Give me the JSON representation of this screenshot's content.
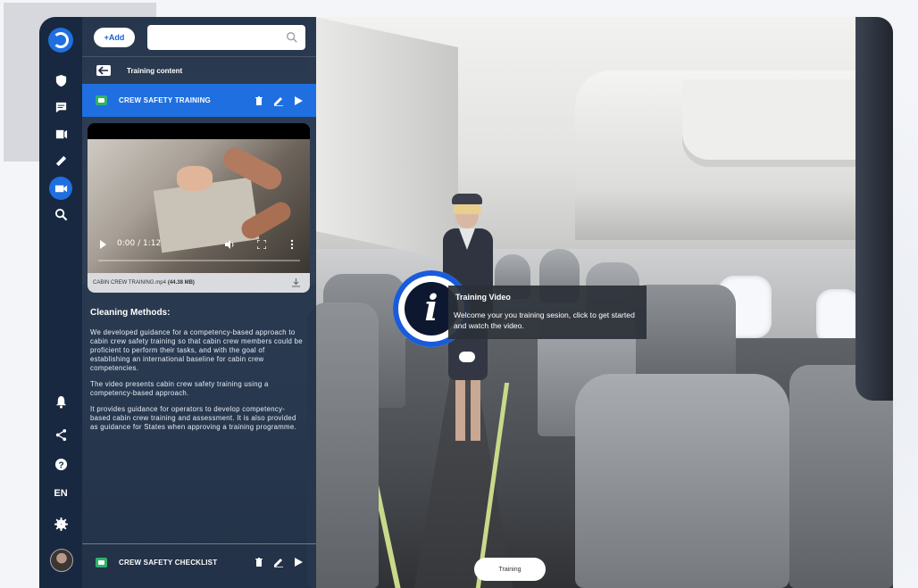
{
  "toolbar": {
    "add_label": "+Add",
    "search_value": ""
  },
  "section": {
    "title": "Training content"
  },
  "items": [
    {
      "label": "CREW SAFETY TRAINING",
      "icon": "video-icon",
      "active": true
    },
    {
      "label": "CREW SAFETY CHECKLIST",
      "icon": "checklist-icon",
      "active": false
    }
  ],
  "video": {
    "current_time": "0:00 / 1:12",
    "progress": 0.0,
    "file_name": "CABIN CREW TRAINING.mp4",
    "file_size": "(44.38 MB)"
  },
  "description": {
    "heading": "Cleaning Methods:",
    "paragraphs": [
      "We developed guidance for a competency-based approach to cabin crew safety training so that cabin crew members could be proficient to perform their tasks, and with the goal of establishing an international baseline for cabin crew competencies.",
      "The video presents cabin crew safety training using a competency-based approach.",
      "It provides guidance for operators to develop competency-based cabin crew training and assessment. It is also provided as guidance for States when approving a training programme."
    ]
  },
  "hotspot": {
    "glyph": "i",
    "title": "Training Video",
    "text": "Welcome your you training sesion, click to get started and watch the video."
  },
  "scene_pill": "Training",
  "rail": {
    "language": "EN",
    "icons": [
      "logo-icon",
      "shield-icon",
      "chat-icon",
      "media-icon",
      "ruler-icon",
      "video-icon",
      "search-icon",
      "bell-icon",
      "share-icon",
      "help-icon",
      "language",
      "settings-icon",
      "avatar"
    ]
  },
  "colors": {
    "accent": "#1f6fe0",
    "sidebar": "#172840",
    "item_icon_green": "#2fb36a"
  }
}
